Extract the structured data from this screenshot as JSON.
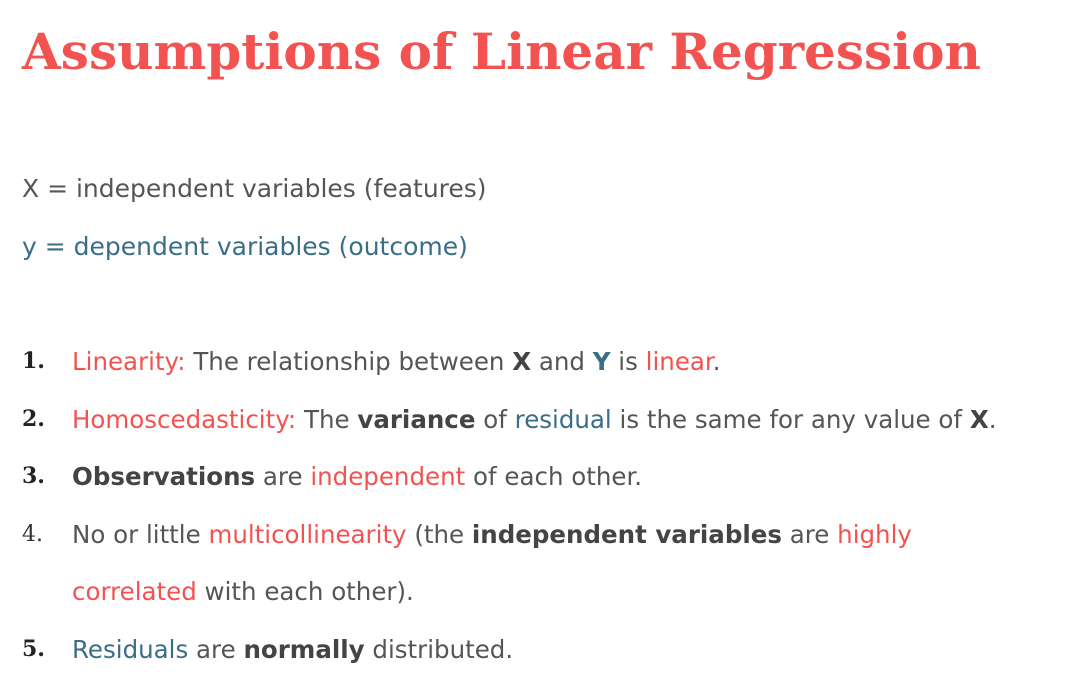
{
  "title": "Assumptions of Linear Regression",
  "definitions": {
    "x": "X = independent variables (features)",
    "y": "y = dependent variables (outcome)"
  },
  "assumptions": [
    {
      "number": "1.",
      "term": "Linearity:",
      "t1": " The relationship between ",
      "x": "X",
      "t2": " and ",
      "y": "Y",
      "t3": " is ",
      "linear": "linear",
      "t4": "."
    },
    {
      "number": "2.",
      "term": "Homoscedasticity:",
      "t1": " The ",
      "variance": "variance",
      "t2": " of ",
      "residual": "residual",
      "t3": " is the same for any value of ",
      "x": "X",
      "t4": "."
    },
    {
      "number": "3.",
      "observations": "Observations",
      "t1": " are ",
      "independent": "independent",
      "t2": " of each other."
    },
    {
      "number": "4.",
      "t1": "No or little ",
      "multicollinearity": "multicollinearity",
      "t2": " (the ",
      "indep_vars": "independent variables",
      "t3": " are ",
      "highly": "highly",
      "correlated": "correlated",
      "t4": " with each other)."
    },
    {
      "number": "5.",
      "residuals": "Residuals",
      "t1": " are ",
      "normally": "normally",
      "t2": " distributed."
    }
  ],
  "colors": {
    "accent_red": "#f25350",
    "accent_blue": "#3a6d88",
    "text_gray": "#555555"
  }
}
